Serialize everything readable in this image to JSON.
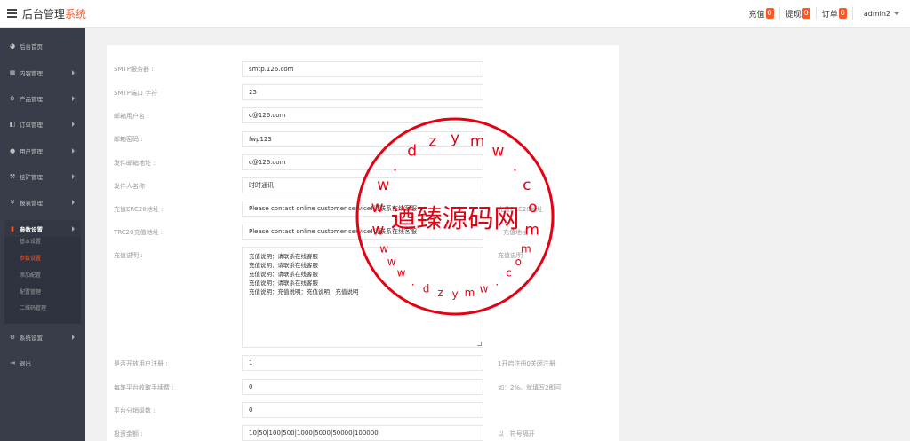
{
  "header": {
    "title_main": "后台管理",
    "title_accent": "系统",
    "recharge_label": "充值",
    "recharge_count": "0",
    "withdraw_label": "提现",
    "withdraw_count": "0",
    "order_label": "订单",
    "order_count": "0",
    "admin_name": "admin2"
  },
  "sidebar": {
    "items": [
      {
        "icon": "dashboard-icon",
        "glyph": "◕",
        "label": "后台首页"
      },
      {
        "icon": "content-icon",
        "glyph": "▦",
        "label": "内容管理"
      },
      {
        "icon": "product-icon",
        "glyph": "฿",
        "label": "产品管理"
      },
      {
        "icon": "order-icon",
        "glyph": "◧",
        "label": "订单管理"
      },
      {
        "icon": "user-icon",
        "glyph": "●",
        "label": "用户管理"
      },
      {
        "icon": "mining-icon",
        "glyph": "⚒",
        "label": "挖矿管理"
      },
      {
        "icon": "report-icon",
        "glyph": "¥",
        "label": "报表管理"
      },
      {
        "icon": "settings-icon",
        "glyph": "▮",
        "label": "参数设置"
      },
      {
        "icon": "system-icon",
        "glyph": "⚙",
        "label": "系统设置"
      },
      {
        "icon": "logout-icon",
        "glyph": "⇥",
        "label": "退出"
      }
    ],
    "sub_items": [
      "基本设置",
      "参数设置",
      "添加配置",
      "配置管理",
      "二维码管理"
    ]
  },
  "form": {
    "smtp_server_label": "SMTP服务器 :",
    "smtp_server_value": "smtp.126.com",
    "smtp_port_label": "SMTP端口 字符",
    "smtp_port_value": "25",
    "mail_user_label": "邮箱用户名 :",
    "mail_user_value": "c@126.com",
    "mail_password_label": "邮箱密码 :",
    "mail_password_value": "fwp123",
    "sender_address_label": "发件邮箱地址 :",
    "sender_address_value": "c@126.com",
    "sender_name_label": "发件人名称 :",
    "sender_name_value": "时时通讯",
    "erc20_label": "充值ERC20地址 :",
    "erc20_value": "Please contact online customer service!请联系在线客服",
    "erc20_side": "充值ERC20地址",
    "trc20_label": "TRC20充值地址 :",
    "trc20_value": "Please contact online customer service!请联系在线客服",
    "trc20_side": "充值地址",
    "recharge_desc_label": "充值说明 :",
    "recharge_desc_lines": [
      "充值说明：请联系在线客服",
      "充值说明：请联系在线客服",
      "充值说明：请联系在线客服",
      "充值说明：请联系在线客服",
      "充值说明：充值说明：充值说明：充值说明"
    ],
    "recharge_desc_side": "充值说明",
    "register_label": "是否开放用户注册 :",
    "register_value": "1",
    "register_side": "1开启注册0关闭注册",
    "fee_label": "每笔平台收取手续费 :",
    "fee_value": "0",
    "fee_side": "如：2%。就填写2即可",
    "levels_label": "平台分销级数 :",
    "levels_value": "0",
    "invest_label": "投资金额 :",
    "invest_value": "10|50|100|500|1000|5000|50000|100000",
    "invest_side": "以 | 符号隔开"
  },
  "watermark": {
    "center_text": "遒臻源码网",
    "ring_text": "www.dzymw.com",
    "color": "#e60012"
  }
}
